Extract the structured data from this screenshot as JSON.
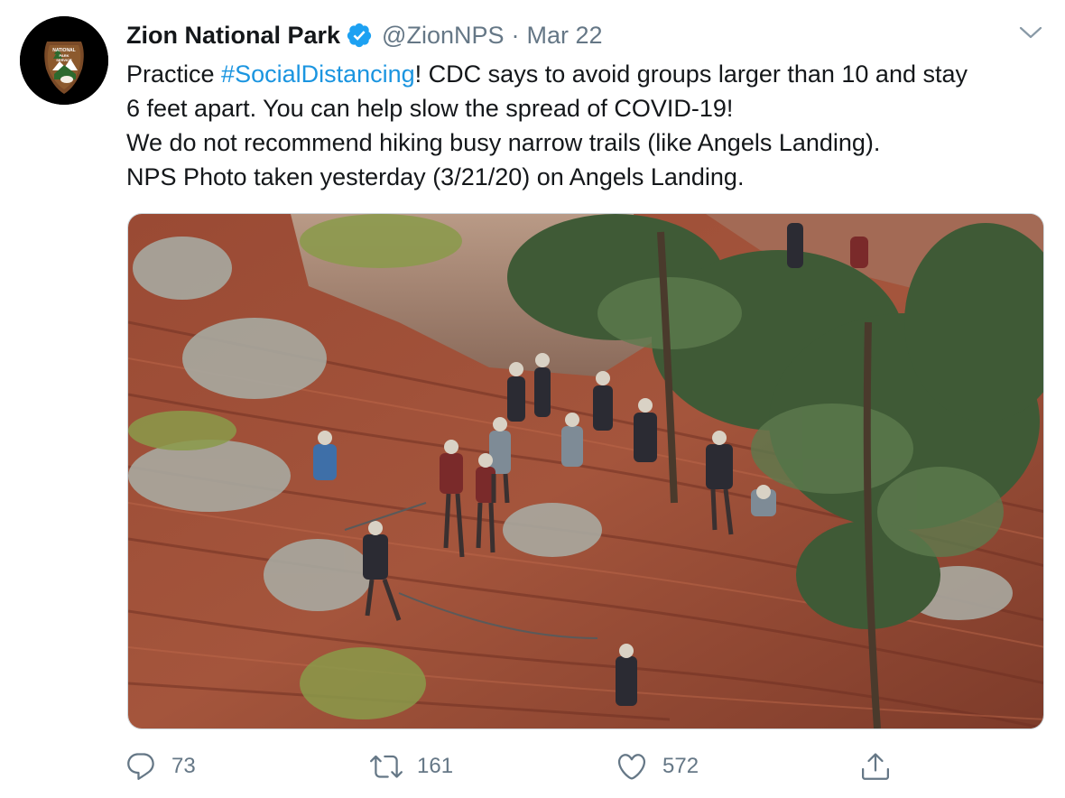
{
  "tweet": {
    "author_name": "Zion National Park",
    "author_handle": "@ZionNPS",
    "separator": "·",
    "date": "Mar 22",
    "avatar_logo_text": [
      "NATIONAL",
      "PARK",
      "SERVICE"
    ],
    "text": {
      "prefix": "Practice ",
      "hashtag": "#SocialDistancing",
      "line1_rest": "! CDC says to avoid groups larger than 10 and stay",
      "line2": "6 feet apart. You can help slow the spread of COVID-19!",
      "line3": "We do not recommend hiking busy narrow trails (like Angels Landing).",
      "line4": "NPS Photo taken yesterday (3/21/20) on Angels Landing."
    },
    "actions": {
      "replies": "73",
      "retweets": "161",
      "likes": "572"
    }
  },
  "colors": {
    "link": "#1b95e0",
    "verified": "#1da1f2",
    "secondary_text": "#657786",
    "icon": "#657786"
  },
  "icons": [
    "verified-badge-icon",
    "chevron-down-icon",
    "reply-icon",
    "retweet-icon",
    "like-icon",
    "share-icon"
  ]
}
